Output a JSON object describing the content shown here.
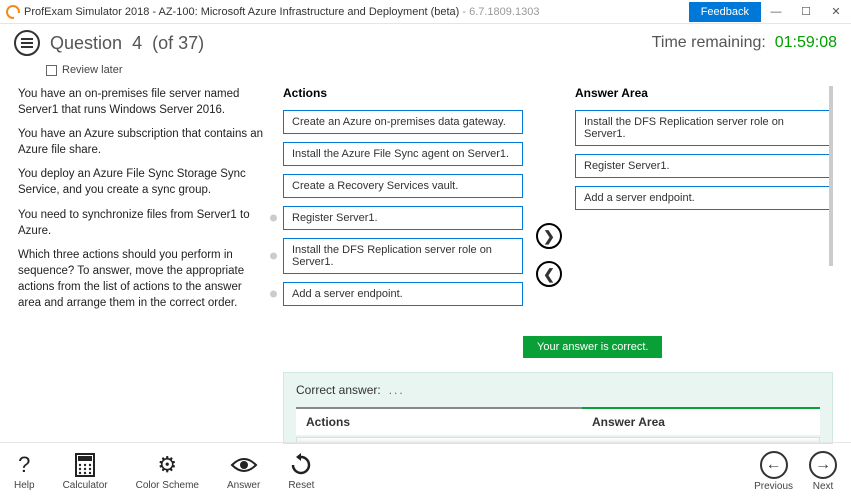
{
  "titlebar": {
    "app": "ProfExam Simulator 2018 - AZ-100: Microsoft Azure Infrastructure and Deployment (beta)",
    "version": " - 6.7.1809.1303",
    "feedback": "Feedback"
  },
  "header": {
    "question_label": "Question",
    "question_num": "4",
    "question_total": "(of 37)",
    "time_label": "Time remaining:",
    "time_value": "01:59:08"
  },
  "review_label": "Review later",
  "question": {
    "p1": "You have an on-premises file server named Server1 that runs Windows Server 2016.",
    "p2": "You have an Azure subscription that contains an Azure file share.",
    "p3": "You deploy an Azure File Sync Storage Sync Service, and you create a sync group.",
    "p4": "You need to synchronize files from Server1 to Azure.",
    "p5": "Which three actions should you perform in sequence? To answer, move the appropriate actions from the list of actions to the answer area and arrange them in the correct order."
  },
  "cols": {
    "actions_title": "Actions",
    "answer_title": "Answer Area",
    "actions": [
      "Create an Azure on-premises data gateway.",
      "Install the Azure File Sync agent on Server1.",
      "Create a Recovery Services vault.",
      "Register Server1.",
      "Install the DFS Replication server role on Server1.",
      "Add a server endpoint."
    ],
    "answers": [
      "Install the DFS Replication server role on Server1.",
      "Register Server1.",
      "Add a server endpoint."
    ]
  },
  "feedback_msg": "Your answer is correct.",
  "correct_label": "Correct answer:",
  "correct_cols": {
    "c1": "Actions",
    "c2": "Answer Area"
  },
  "footer": {
    "help": "Help",
    "calculator": "Calculator",
    "colorscheme": "Color Scheme",
    "answer": "Answer",
    "reset": "Reset",
    "previous": "Previous",
    "next": "Next"
  }
}
